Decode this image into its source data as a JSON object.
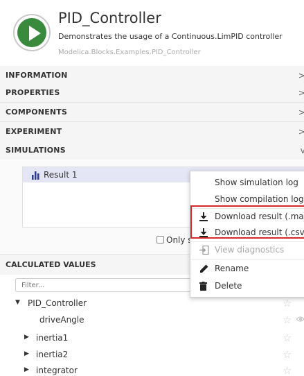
{
  "model": {
    "title": "PID_Controller",
    "description": "Demonstrates the usage of a Continuous.LimPID controller",
    "path": "Modelica.Blocks.Examples.PID_Controller"
  },
  "sections": [
    {
      "label": "INFORMATION",
      "chevron": ">"
    },
    {
      "label": "PROPERTIES",
      "chevron": ">"
    },
    {
      "label": "COMPONENTS",
      "chevron": ">"
    },
    {
      "label": "EXPERIMENT",
      "chevron": ">"
    },
    {
      "label": "SIMULATIONS",
      "chevron": "v"
    }
  ],
  "simulations": {
    "results": [
      {
        "label": "Result 1"
      }
    ],
    "only_checkbox_label": "Only s"
  },
  "context_menu": {
    "items": [
      {
        "label": "Show simulation log",
        "icon": "none"
      },
      {
        "label": "Show compilation log",
        "icon": "none"
      },
      {
        "label": "Download result (.mat",
        "icon": "download-icon"
      },
      {
        "label": "Download result (.csv)",
        "icon": "download-icon"
      },
      {
        "label": "View diagnostics",
        "icon": "diagnostics-icon",
        "disabled": true
      },
      {
        "label": "Rename",
        "icon": "pencil-icon"
      },
      {
        "label": "Delete",
        "icon": "trash-icon"
      }
    ]
  },
  "calculated": {
    "header": "CALCULATED VALUES",
    "filter_placeholder": "Filter...",
    "tree": [
      {
        "label": "PID_Controller",
        "expanded": true,
        "level": 0
      },
      {
        "label": "driveAngle",
        "level": 1,
        "eye": true
      },
      {
        "label": "inertia1",
        "expanded": false,
        "level": 0
      },
      {
        "label": "inertia2",
        "expanded": false,
        "level": 0
      },
      {
        "label": "integrator",
        "expanded": false,
        "level": 0
      }
    ]
  },
  "colors": {
    "play_green": "#3a8a3e",
    "selected_row": "#e4e6f6",
    "highlight_red": "#d42a2a",
    "chart_icon": "#2b3a8f"
  }
}
